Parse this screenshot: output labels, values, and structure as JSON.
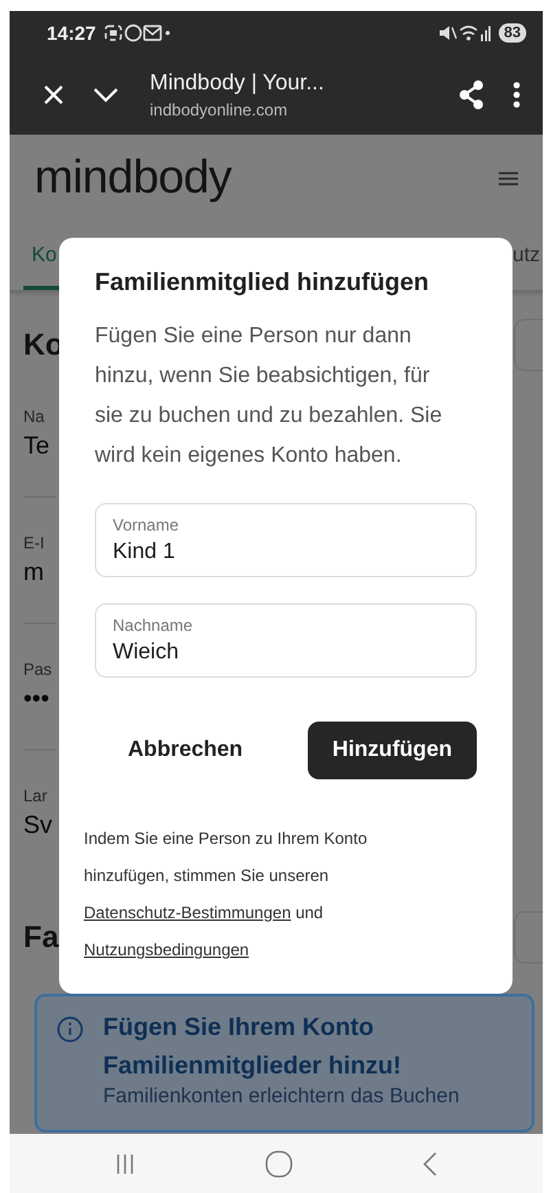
{
  "status_bar": {
    "time": "14:27",
    "battery": "83"
  },
  "browser": {
    "title": "Mindbody | Your...",
    "url": "indbodyonline.com"
  },
  "page": {
    "logo": "mindbody",
    "tabs": [
      {
        "label": "Ko",
        "selected": true
      },
      {
        "label": "utz",
        "selected": false
      }
    ],
    "heading": "Ko",
    "fields": [
      {
        "label": "Na",
        "value": "Te"
      },
      {
        "label": "E-I",
        "value": "m"
      },
      {
        "label": "Pas",
        "value": "•••"
      },
      {
        "label": "Lar",
        "value": "Sv"
      }
    ],
    "section_heading": "Fa",
    "info": {
      "title": "Fügen Sie Ihrem Konto Familienmitglieder hinzu!",
      "text": "Familienkonten erleichtern das Buchen"
    }
  },
  "dialog": {
    "title": "Familienmitglied hinzufügen",
    "body": "Fügen Sie eine Person nur dann hinzu, wenn Sie beabsichtigen, für sie zu buchen und zu bezahlen. Sie wird kein eigenes Konto haben.",
    "fields": [
      {
        "label": "Vorname",
        "value": "Kind 1"
      },
      {
        "label": "Nachname",
        "value": "Wieich"
      }
    ],
    "cancel": "Abbrechen",
    "submit": "Hinzufügen",
    "legal": {
      "before": "Indem Sie eine Person zu Ihrem Konto hinzufügen, stimmen Sie unseren",
      "privacy_link": "Datenschutz-Bestimmungen",
      "middle": "und",
      "terms_link": "Nutzungsbedingungen"
    }
  }
}
